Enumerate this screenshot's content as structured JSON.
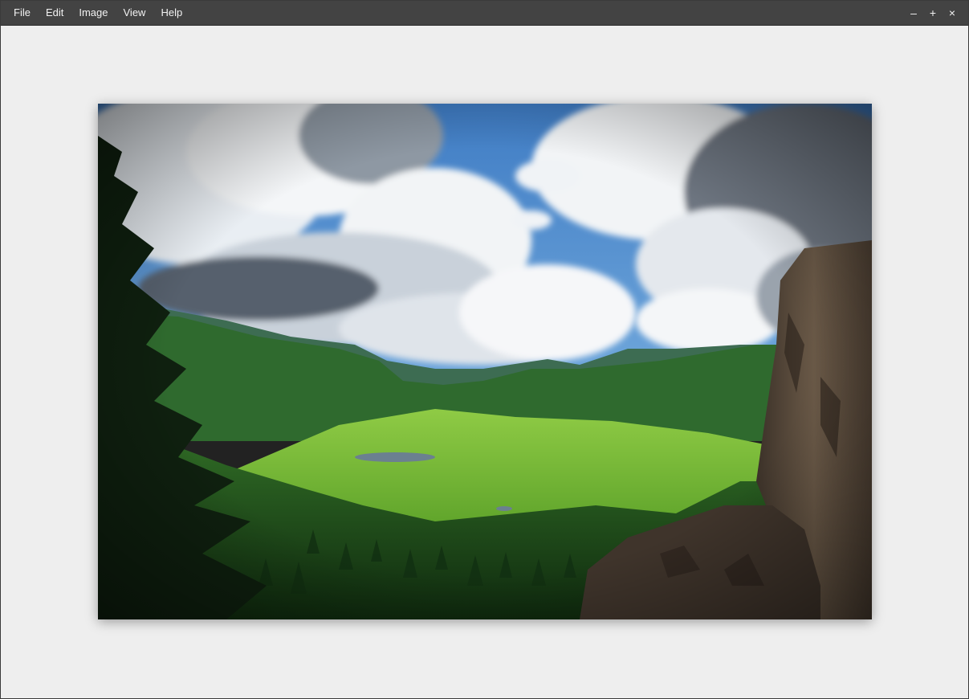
{
  "menu": {
    "items": [
      {
        "label": "File"
      },
      {
        "label": "Edit"
      },
      {
        "label": "Image"
      },
      {
        "label": "View"
      },
      {
        "label": "Help"
      }
    ]
  },
  "window_controls": {
    "minimize": "–",
    "maximize": "+",
    "close": "×"
  },
  "colors": {
    "menubar_bg": "#434343",
    "canvas_bg": "#eeeeee",
    "sky": "#4a86c8",
    "meadow": "#7fc23a",
    "forest": "#1f4a1c",
    "rock": "#5a4a3c"
  },
  "image": {
    "subject": "mountain valley with meadows, forest, cliff and cumulus clouds"
  }
}
